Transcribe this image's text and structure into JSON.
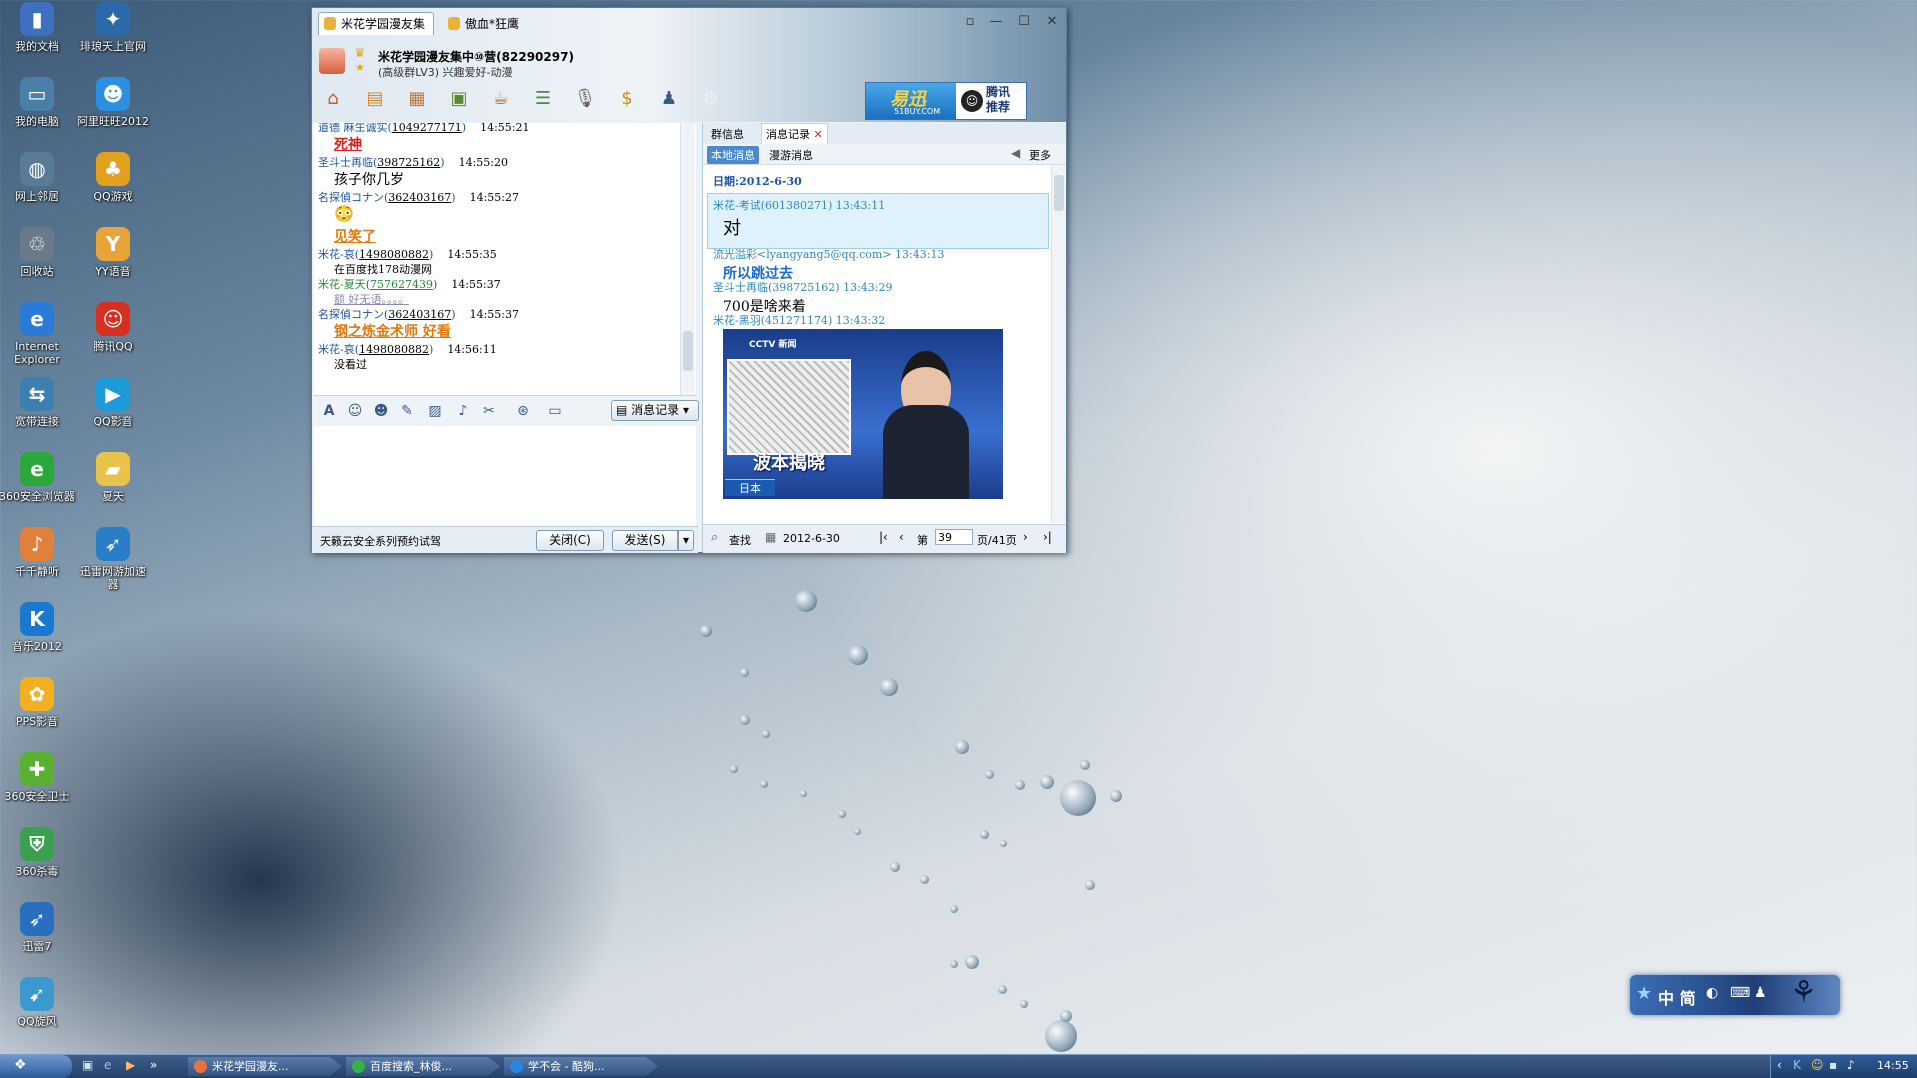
{
  "desktop_icons": [
    {
      "label": "我的文档",
      "icon": "folder-documents-icon",
      "color": "#3f6fc0",
      "glyph": "▮"
    },
    {
      "label": "琲琅天上官网",
      "icon": "game-site-icon",
      "color": "#2a6aa8",
      "glyph": "✦"
    },
    {
      "label": "我的电脑",
      "icon": "computer-icon",
      "color": "#4a7fa8",
      "glyph": "▭"
    },
    {
      "label": "阿里旺旺2012",
      "icon": "aliwangwang-icon",
      "color": "#2d8fe0",
      "glyph": "☻"
    },
    {
      "label": "网上邻居",
      "icon": "network-icon",
      "color": "#5a7b95",
      "glyph": "◍"
    },
    {
      "label": "QQ游戏",
      "icon": "qq-game-icon",
      "color": "#e0a020",
      "glyph": "♣"
    },
    {
      "label": "回收站",
      "icon": "recycle-bin-icon",
      "color": "#6a7a88",
      "glyph": "♲"
    },
    {
      "label": "YY语音",
      "icon": "yy-voice-icon",
      "color": "#e8a33a",
      "glyph": "Y"
    },
    {
      "label": "Internet Explorer",
      "icon": "internet-explorer-icon",
      "color": "#2a7ad8",
      "glyph": "e"
    },
    {
      "label": "腾讯QQ",
      "icon": "tencent-qq-icon",
      "color": "#d83020",
      "glyph": "☺"
    },
    {
      "label": "宽带连接",
      "icon": "broadband-icon",
      "color": "#3d7fb0",
      "glyph": "⇆"
    },
    {
      "label": "QQ影音",
      "icon": "qq-player-icon",
      "color": "#1f9ad8",
      "glyph": "▶"
    },
    {
      "label": "360安全浏览器",
      "icon": "360-browser-icon",
      "color": "#2aa83a",
      "glyph": "e"
    },
    {
      "label": "夏天",
      "icon": "folder-icon",
      "color": "#e8c24a",
      "glyph": "▰"
    },
    {
      "label": "千千静听",
      "icon": "ttplayer-icon",
      "color": "#e0803a",
      "glyph": "♪"
    },
    {
      "label": "迅雷网游加速器",
      "icon": "xunlei-accelerator-icon",
      "color": "#2a7ec8",
      "glyph": "➶"
    },
    {
      "label": "音乐2012",
      "icon": "kugou-music-icon",
      "color": "#1a78d0",
      "glyph": "K"
    },
    {
      "label": "",
      "icon": "",
      "color": "",
      "glyph": ""
    },
    {
      "label": "PPS影音",
      "icon": "pps-player-icon",
      "color": "#f0b020",
      "glyph": "✿"
    },
    {
      "label": "",
      "icon": "",
      "color": "",
      "glyph": ""
    },
    {
      "label": "360安全卫士",
      "icon": "360-safe-icon",
      "color": "#5ab030",
      "glyph": "✚"
    },
    {
      "label": "",
      "icon": "",
      "color": "",
      "glyph": ""
    },
    {
      "label": "360杀毒",
      "icon": "360-antivirus-icon",
      "color": "#3aa050",
      "glyph": "⛨"
    },
    {
      "label": "",
      "icon": "",
      "color": "",
      "glyph": ""
    },
    {
      "label": "迅雷7",
      "icon": "xunlei-icon",
      "color": "#2a6ec0",
      "glyph": "➶"
    },
    {
      "label": "",
      "icon": "",
      "color": "",
      "glyph": ""
    },
    {
      "label": "QQ旋风",
      "icon": "qq-whirlwind-icon",
      "color": "#3a9ad0",
      "glyph": "➹"
    }
  ],
  "qq": {
    "tabs": [
      "米花学园漫友集",
      "傲血*狂鹰"
    ],
    "group_name": "米花学园漫友集中⑩营(82290297)",
    "group_sub": "(高级群LV3) 兴趣爱好-动漫",
    "ad_yixun": "易迅",
    "ad_yixun_url": "51BUY.COM",
    "ad_tencent": "腾讯\n推荐",
    "chat": [
      {
        "kind": "sender",
        "name": "道德 麻玍诚实",
        "qq": "1049277171",
        "time": "14:55:21"
      },
      {
        "kind": "big",
        "text": "死神",
        "color": "#d82020"
      },
      {
        "kind": "sender",
        "name": "圣斗士再临",
        "qq": "398725162",
        "time": "14:55:20"
      },
      {
        "kind": "text",
        "text": "孩子你几岁"
      },
      {
        "kind": "sender",
        "name": "名探偵コナン",
        "qq": "362403167",
        "time": "14:55:27"
      },
      {
        "kind": "emoji",
        "text": "😳"
      },
      {
        "kind": "big",
        "text": "见笑了",
        "color": "#e07a10"
      },
      {
        "kind": "sender",
        "name": "米花-哀",
        "qq": "1498080882",
        "time": "14:55:35"
      },
      {
        "kind": "small",
        "text": "在百度找178动漫网"
      },
      {
        "kind": "sender2",
        "name": "米花-夏天",
        "qq": "757627439",
        "time": "14:55:37"
      },
      {
        "kind": "faint",
        "text": "额 好无语。。。。"
      },
      {
        "kind": "sender",
        "name": "名探偵コナン",
        "qq": "362403167",
        "time": "14:55:37"
      },
      {
        "kind": "big",
        "text": "钢之炼金术师 好看",
        "color": "#e07a10"
      },
      {
        "kind": "sender",
        "name": "米花-哀",
        "qq": "1498080882",
        "time": "14:56:11"
      },
      {
        "kind": "small",
        "text": "没看过"
      }
    ],
    "record_button": "消息记录",
    "bottom_ad": "天籁云安全系列预约试驾",
    "close_button": "关闭(C)",
    "send_button": "发送(S)",
    "right_tabs": [
      "群信息",
      "消息记录"
    ],
    "sub_tabs": [
      "本地消息",
      "漫游消息"
    ],
    "more": "更多",
    "date_label": "日期:",
    "date_value": "2012-6-30",
    "records": [
      {
        "sender": "米花-考试(601380271) 13:43:11",
        "text": "对",
        "style": "plain",
        "highlight": true
      },
      {
        "sender": "流光溢彩<lyangyang5@qq.com> 13:43:13",
        "text": "所以跳过去",
        "style": "blue"
      },
      {
        "sender": "圣斗士再临(398725162) 13:43:29",
        "text": "700是啥来着",
        "style": "plain"
      },
      {
        "sender": "米花-黑羽(451271174) 13:43:32",
        "text": "",
        "style": "image"
      }
    ],
    "tv_image": {
      "logo": "CCTV 新闻",
      "caption": "波本揭晓",
      "tag": "日本"
    },
    "find_label": "查找",
    "footer_date": "2012-6-30",
    "page_prefix": "第",
    "page_value": "39",
    "page_suffix": "页/41页"
  },
  "ime": {
    "text": "中 简"
  },
  "taskbar": {
    "tasks": [
      "米花学园漫友...",
      "百度搜索_林俊...",
      "学不会 - 酷狗..."
    ],
    "clock": "14:55"
  }
}
